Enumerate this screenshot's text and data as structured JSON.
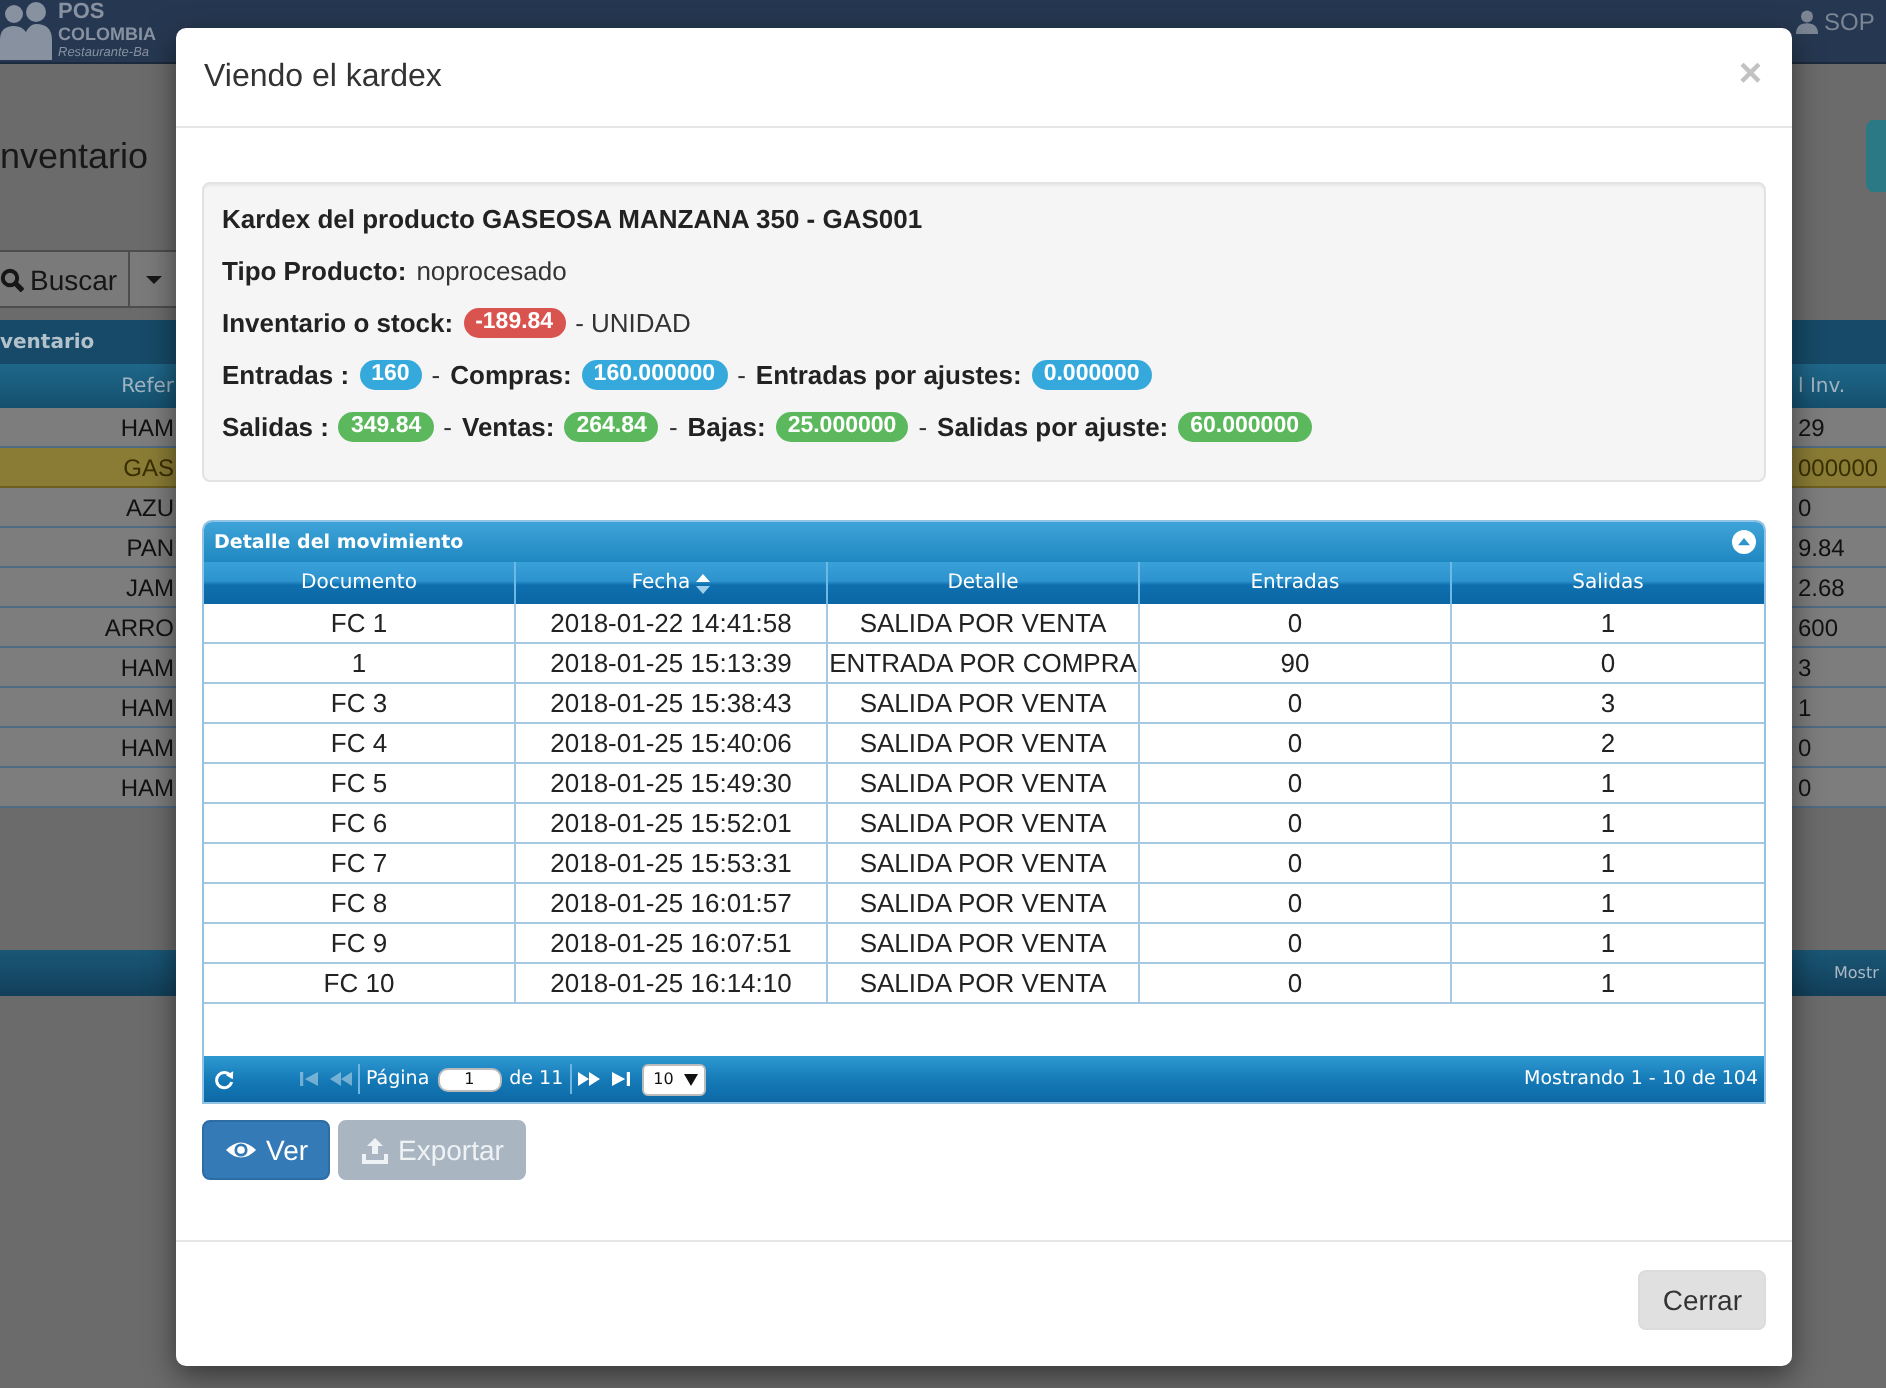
{
  "background_page": {
    "navbar": {
      "logo": {
        "line_1": "POS",
        "line_2": "COLOMBIA",
        "line_3": "Restaurante-Ba"
      },
      "user": "SOP"
    },
    "title": "nventario",
    "toolbar": {
      "search_button": "Buscar"
    },
    "grid": {
      "caption": "ventario",
      "columns": [
        "Refer",
        "l Inv."
      ],
      "rows": [
        {
          "cells": [
            "HAM",
            "29"
          ],
          "selected": false
        },
        {
          "cells": [
            "GAS",
            "000000"
          ],
          "selected": true
        },
        {
          "cells": [
            "AZU",
            "0"
          ],
          "selected": false
        },
        {
          "cells": [
            "PAN",
            "9.84"
          ],
          "selected": false
        },
        {
          "cells": [
            "JAM",
            "2.68"
          ],
          "selected": false
        },
        {
          "cells": [
            "ARRO",
            "600"
          ],
          "selected": false
        },
        {
          "cells": [
            "HAM",
            "3"
          ],
          "selected": false
        },
        {
          "cells": [
            "HAM",
            "1"
          ],
          "selected": false
        },
        {
          "cells": [
            "HAM",
            "0"
          ],
          "selected": false
        },
        {
          "cells": [
            "HAM",
            "0"
          ],
          "selected": false
        }
      ],
      "footer": "Mostr"
    }
  },
  "modal": {
    "title": "Viendo el kardex",
    "close": "×",
    "summary": {
      "title": "Kardex del producto GASEOSA MANZANA 350 - GAS001",
      "lines": [
        {
          "segments": [
            {
              "kind": "label",
              "text": "Tipo Producto:"
            },
            {
              "kind": "text",
              "text": "noprocesado"
            }
          ]
        },
        {
          "segments": [
            {
              "kind": "label",
              "text": "Inventario o stock:"
            },
            {
              "kind": "badge",
              "text": "-189.84",
              "color": "#d9534f"
            },
            {
              "kind": "text",
              "text": "- UNIDAD"
            }
          ]
        },
        {
          "segments": [
            {
              "kind": "label",
              "text": "Entradas :"
            },
            {
              "kind": "badge",
              "text": "160",
              "color": "#36a9dc"
            },
            {
              "kind": "separator",
              "text": "-"
            },
            {
              "kind": "label",
              "text": "Compras:"
            },
            {
              "kind": "badge",
              "text": "160.000000",
              "color": "#36a9dc"
            },
            {
              "kind": "separator",
              "text": "-"
            },
            {
              "kind": "label",
              "text": "Entradas por ajustes:"
            },
            {
              "kind": "badge",
              "text": "0.000000",
              "color": "#36a9dc"
            }
          ]
        },
        {
          "segments": [
            {
              "kind": "label",
              "text": "Salidas :"
            },
            {
              "kind": "badge",
              "text": "349.84",
              "color": "#5cb85c"
            },
            {
              "kind": "separator",
              "text": "-"
            },
            {
              "kind": "label",
              "text": "Ventas:"
            },
            {
              "kind": "badge",
              "text": "264.84",
              "color": "#5cb85c"
            },
            {
              "kind": "separator",
              "text": "-"
            },
            {
              "kind": "label",
              "text": "Bajas:"
            },
            {
              "kind": "badge",
              "text": "25.000000",
              "color": "#5cb85c"
            },
            {
              "kind": "separator",
              "text": "-"
            },
            {
              "kind": "label",
              "text": "Salidas por ajuste:"
            },
            {
              "kind": "badge",
              "text": "60.000000",
              "color": "#5cb85c"
            }
          ]
        }
      ]
    },
    "grid": {
      "caption": "Detalle del movimiento",
      "columns": [
        {
          "label": "Documento",
          "sorted": false
        },
        {
          "label": "Fecha",
          "sorted": true
        },
        {
          "label": "Detalle",
          "sorted": false
        },
        {
          "label": "Entradas",
          "sorted": false
        },
        {
          "label": "Salidas",
          "sorted": false
        }
      ],
      "rows": [
        [
          "FC 1",
          "2018-01-22 14:41:58",
          "SALIDA POR VENTA",
          "0",
          "1"
        ],
        [
          "1",
          "2018-01-25 15:13:39",
          "ENTRADA POR COMPRA",
          "90",
          "0"
        ],
        [
          "FC 3",
          "2018-01-25 15:38:43",
          "SALIDA POR VENTA",
          "0",
          "3"
        ],
        [
          "FC 4",
          "2018-01-25 15:40:06",
          "SALIDA POR VENTA",
          "0",
          "2"
        ],
        [
          "FC 5",
          "2018-01-25 15:49:30",
          "SALIDA POR VENTA",
          "0",
          "1"
        ],
        [
          "FC 6",
          "2018-01-25 15:52:01",
          "SALIDA POR VENTA",
          "0",
          "1"
        ],
        [
          "FC 7",
          "2018-01-25 15:53:31",
          "SALIDA POR VENTA",
          "0",
          "1"
        ],
        [
          "FC 8",
          "2018-01-25 16:01:57",
          "SALIDA POR VENTA",
          "0",
          "1"
        ],
        [
          "FC 9",
          "2018-01-25 16:07:51",
          "SALIDA POR VENTA",
          "0",
          "1"
        ],
        [
          "FC 10",
          "2018-01-25 16:14:10",
          "SALIDA POR VENTA",
          "0",
          "1"
        ]
      ],
      "pager": {
        "nav": [
          {
            "kind": "first",
            "disabled": true
          },
          {
            "kind": "prev",
            "disabled": true
          },
          {
            "kind": "next",
            "disabled": false
          },
          {
            "kind": "last",
            "disabled": false
          }
        ],
        "page_label": "Página",
        "page": "1",
        "page_count": "de 11",
        "page_size": "10",
        "info": "Mostrando 1 - 10 de 104"
      }
    },
    "buttons": [
      {
        "label": "Ver",
        "kind": "view",
        "disabled": false
      },
      {
        "label": "Exportar",
        "kind": "export",
        "disabled": true
      }
    ],
    "footer_button": "Cerrar"
  }
}
